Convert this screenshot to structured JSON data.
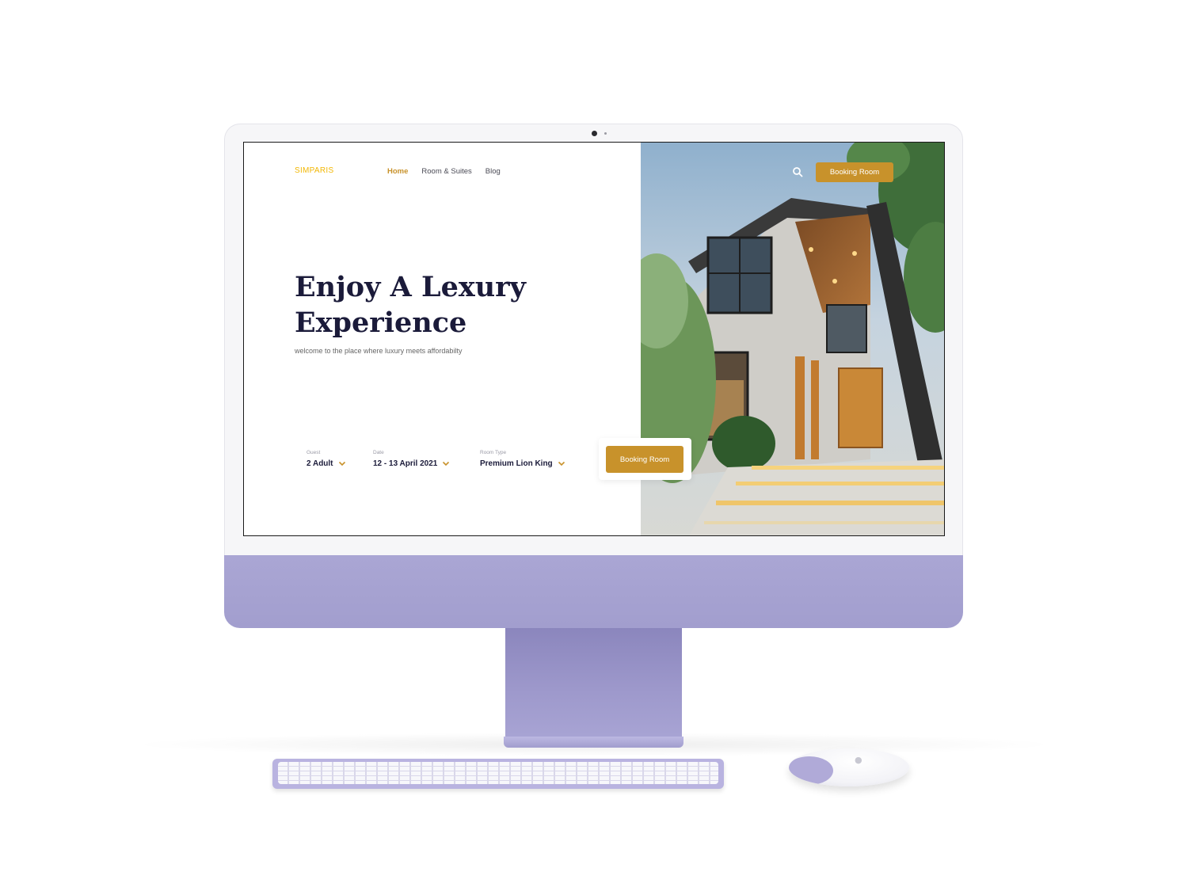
{
  "site": {
    "brand": "SIMPARIS",
    "nav": [
      {
        "label": "Home",
        "active": true
      },
      {
        "label": "Room & Suites",
        "active": false
      },
      {
        "label": "Blog",
        "active": false
      }
    ],
    "header_button": "Booking Room",
    "search_icon": "search-icon"
  },
  "hero": {
    "title": "Enjoy A Lexury Experience",
    "subtitle": "welcome to the place where luxury meets affordabilty"
  },
  "booking": {
    "guest": {
      "label": "Guest",
      "value": "2 Adult"
    },
    "date": {
      "label": "Date",
      "value": "12 - 13 April 2021"
    },
    "room_type": {
      "label": "Room Type",
      "value": "Premium Lion King"
    },
    "button": "Booking Room"
  },
  "colors": {
    "accent": "#c8922b",
    "brand": "#f2b705",
    "heading": "#1b1b3a",
    "device": "#a29ece"
  }
}
